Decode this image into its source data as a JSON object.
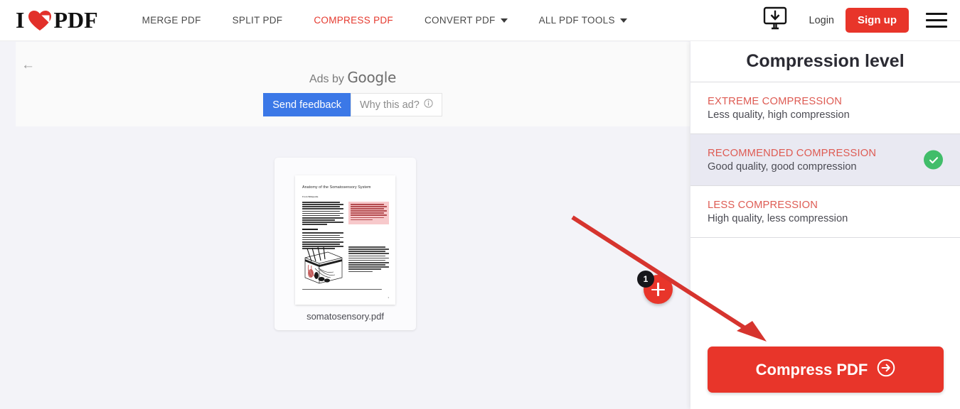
{
  "header": {
    "logo": {
      "left": "I",
      "heart_icon": "heart-icon",
      "right": "PDF"
    },
    "nav": [
      {
        "label": "MERGE PDF",
        "active": false,
        "dropdown": false
      },
      {
        "label": "SPLIT PDF",
        "active": false,
        "dropdown": false
      },
      {
        "label": "COMPRESS PDF",
        "active": true,
        "dropdown": false
      },
      {
        "label": "CONVERT PDF",
        "active": false,
        "dropdown": true
      },
      {
        "label": "ALL PDF TOOLS",
        "active": false,
        "dropdown": true
      }
    ],
    "download_icon": "desktop-download-icon",
    "login_label": "Login",
    "signup_label": "Sign up",
    "menu_icon": "hamburger-menu-icon"
  },
  "ad": {
    "back_icon": "back-arrow-icon",
    "ads_by_prefix": "Ads by ",
    "ads_by_brand": "Google",
    "send_feedback_label": "Send feedback",
    "why_this_ad_label": "Why this ad?",
    "info_icon": "info-circle-icon"
  },
  "workspace": {
    "file": {
      "name": "somatosensory.pdf",
      "doc_title": "Anatomy of the Somatosensory System",
      "doc_author": "From Wikipedia",
      "section_heading": "Somatic sensation",
      "page_number": "1"
    },
    "add_button": {
      "icon": "plus-icon",
      "badge_count": "1"
    },
    "annotation_arrow": "red-pointer-arrow"
  },
  "sidebar": {
    "title": "Compression level",
    "levels": [
      {
        "title": "EXTREME COMPRESSION",
        "desc": "Less quality, high compression",
        "selected": false
      },
      {
        "title": "RECOMMENDED COMPRESSION",
        "desc": "Good quality, good compression",
        "selected": true
      },
      {
        "title": "LESS COMPRESSION",
        "desc": "High quality, less compression",
        "selected": false
      }
    ],
    "check_icon": "check-circle-icon",
    "action_label": "Compress PDF",
    "action_icon": "arrow-right-circle-icon"
  },
  "colors": {
    "brand_red": "#e8352a",
    "level_title_red": "#de5b53",
    "selected_bg": "#e9e9f2",
    "check_green": "#41bd6a",
    "page_bg": "#f3f3f8",
    "ad_blue": "#3b78e7",
    "badge_dark": "#17171b"
  }
}
